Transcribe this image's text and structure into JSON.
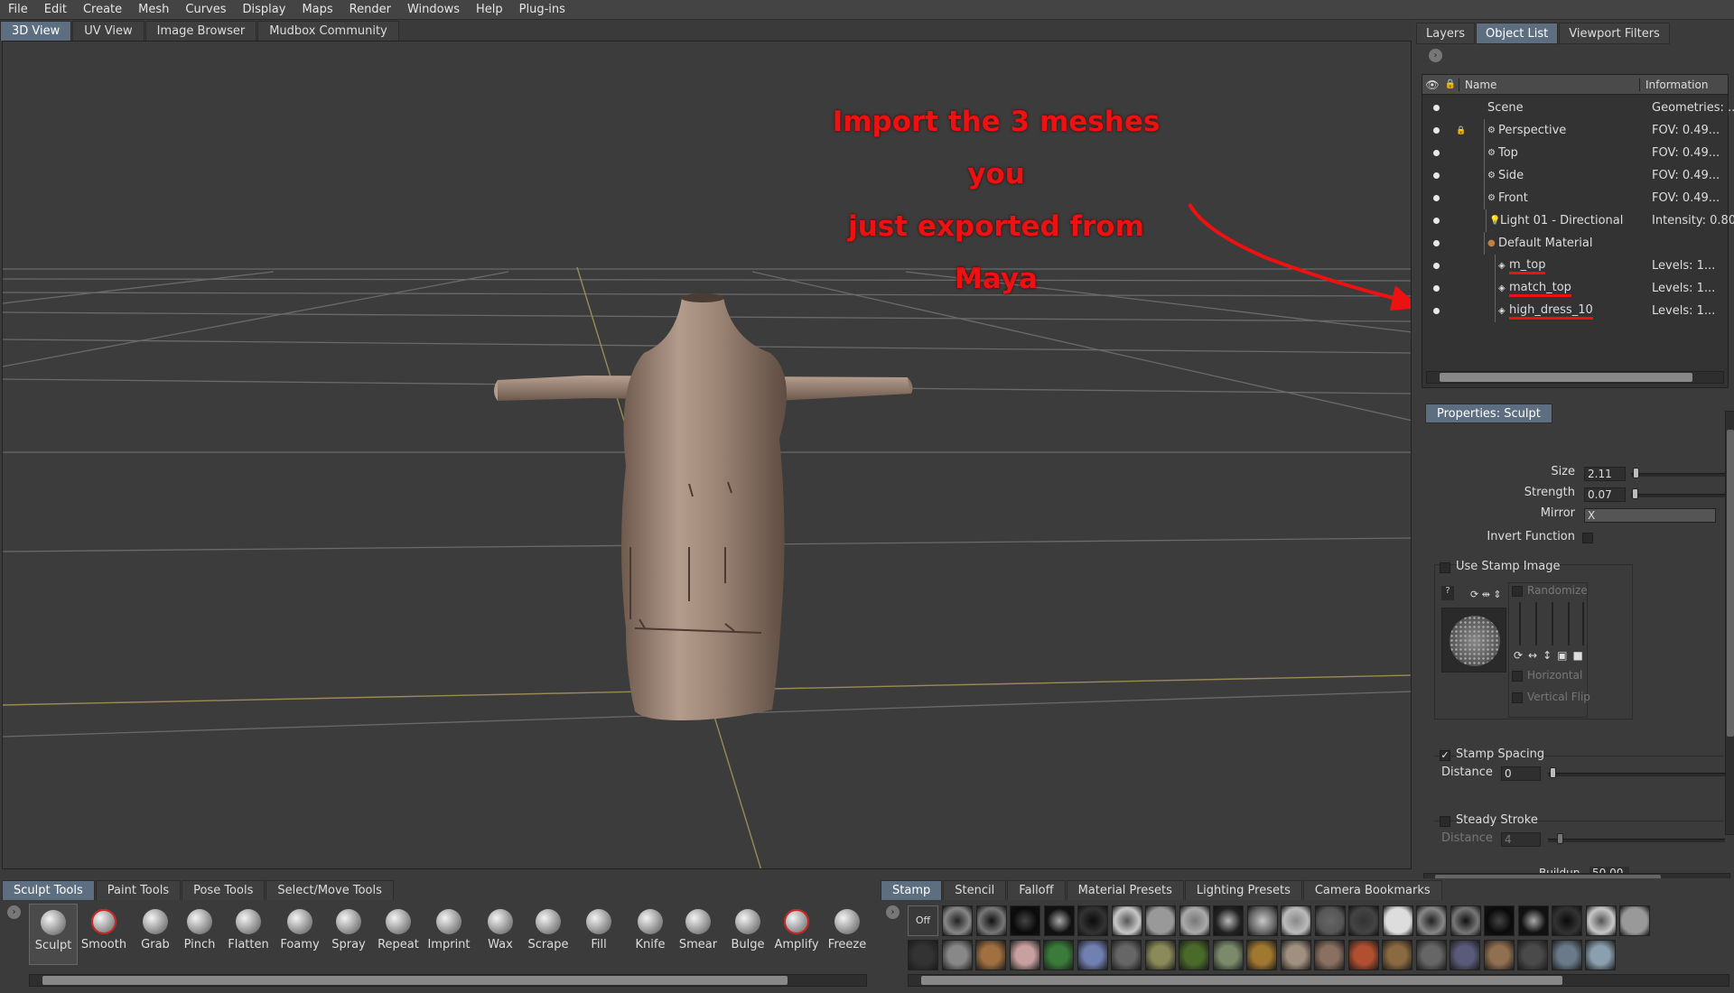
{
  "menu": [
    "File",
    "Edit",
    "Create",
    "Mesh",
    "Curves",
    "Display",
    "Maps",
    "Render",
    "Windows",
    "Help",
    "Plug-ins"
  ],
  "view_tabs": [
    {
      "label": "3D View",
      "active": true
    },
    {
      "label": "UV View",
      "active": false
    },
    {
      "label": "Image Browser",
      "active": false
    },
    {
      "label": "Mudbox Community",
      "active": false
    }
  ],
  "annotation": {
    "line1": "Import the 3 meshes you",
    "line2": "just exported from Maya",
    "color": "#ee1111"
  },
  "right_tabs": [
    {
      "label": "Layers",
      "active": false
    },
    {
      "label": "Object List",
      "active": true
    },
    {
      "label": "Viewport Filters",
      "active": false
    }
  ],
  "object_list": {
    "columns": {
      "name": "Name",
      "info": "Information"
    },
    "rows": [
      {
        "name": "Scene",
        "info": "Geometries: ...",
        "icon": "none",
        "locked": false
      },
      {
        "name": "Perspective",
        "info": "FOV: 0.49...",
        "icon": "camera-icon",
        "locked": true
      },
      {
        "name": "Top",
        "info": "FOV: 0.49...",
        "icon": "camera-icon",
        "locked": false
      },
      {
        "name": "Side",
        "info": "FOV: 0.49...",
        "icon": "camera-icon",
        "locked": false
      },
      {
        "name": "Front",
        "info": "FOV: 0.49...",
        "icon": "camera-icon",
        "locked": false
      },
      {
        "name": "Light 01 - Directional",
        "info": "Intensity: 0.80",
        "icon": "light-icon",
        "locked": false
      },
      {
        "name": "Default Material",
        "info": "",
        "icon": "material-icon",
        "locked": false
      },
      {
        "name": "m_top",
        "info": "Levels: 1...",
        "icon": "mesh-icon",
        "locked": false
      },
      {
        "name": "match_top",
        "info": "Levels: 1...",
        "icon": "mesh-icon",
        "locked": false
      },
      {
        "name": "high_dress_10",
        "info": "Levels: 1...",
        "icon": "mesh-icon",
        "locked": false
      }
    ]
  },
  "properties": {
    "title": "Properties: Sculpt",
    "size_label": "Size",
    "size": "2.11",
    "strength_label": "Strength",
    "strength": "0.07",
    "mirror_label": "Mirror",
    "mirror": "X",
    "invert_label": "Invert Function",
    "use_stamp_label": "Use Stamp Image",
    "randomize_label": "Randomize",
    "horizontal_label": "Horizontal",
    "vertical_label": "Vertical Flip",
    "stamp_spacing_label": "Stamp Spacing",
    "stamp_spacing_checked": true,
    "distance_label": "Distance",
    "distance": "0",
    "steady_label": "Steady Stroke",
    "steady_distance_label": "Distance",
    "steady_distance": "4",
    "buildup_label": "Buildup",
    "buildup": "50.00"
  },
  "bottom_left_tabs": [
    {
      "label": "Sculpt Tools",
      "active": true
    },
    {
      "label": "Paint Tools",
      "active": false
    },
    {
      "label": "Pose Tools",
      "active": false
    },
    {
      "label": "Select/Move Tools",
      "active": false
    }
  ],
  "tools": [
    "Sculpt",
    "Smooth",
    "Grab",
    "Pinch",
    "Flatten",
    "Foamy",
    "Spray",
    "Repeat",
    "Imprint",
    "Wax",
    "Scrape",
    "Fill",
    "Knife",
    "Smear",
    "Bulge",
    "Amplify",
    "Freeze"
  ],
  "bottom_right_tabs": [
    {
      "label": "Stamp",
      "active": true
    },
    {
      "label": "Stencil",
      "active": false
    },
    {
      "label": "Falloff",
      "active": false
    },
    {
      "label": "Material Presets",
      "active": false
    },
    {
      "label": "Lighting Presets",
      "active": false
    },
    {
      "label": "Camera Bookmarks",
      "active": false
    }
  ],
  "stamp_off_label": "Off"
}
